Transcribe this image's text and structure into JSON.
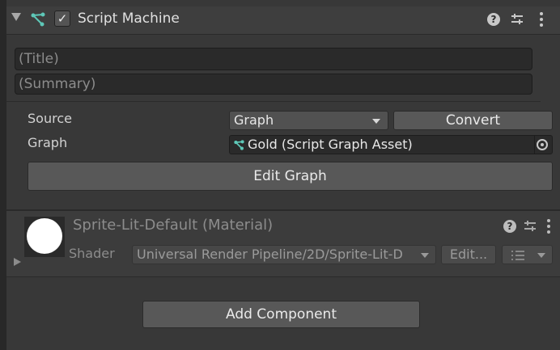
{
  "script_machine": {
    "title": "Script Machine",
    "enabled_check": "✓",
    "title_placeholder": "(Title)",
    "summary_placeholder": "(Summary)",
    "source_label": "Source",
    "source_value": "Graph",
    "convert_label": "Convert",
    "graph_label": "Graph",
    "graph_value": "Gold (Script Graph Asset)",
    "edit_graph_label": "Edit Graph",
    "icons": [
      "script-graph-icon",
      "help-icon",
      "preset-icon",
      "more-options-icon",
      "object-picker-icon"
    ]
  },
  "material": {
    "title": "Sprite-Lit-Default (Material)",
    "shader_label": "Shader",
    "shader_value": "Universal Render Pipeline/2D/Sprite-Lit-D",
    "edit_label": "Edit...",
    "preview_color": "#ffffff"
  },
  "add_component_label": "Add Component",
  "colors": {
    "panel_bg": "#383838",
    "header_bg": "#3e3e3e",
    "field_bg": "#2a2a2a",
    "button_bg": "#585858",
    "graph_icon": "#5ec8b8"
  }
}
